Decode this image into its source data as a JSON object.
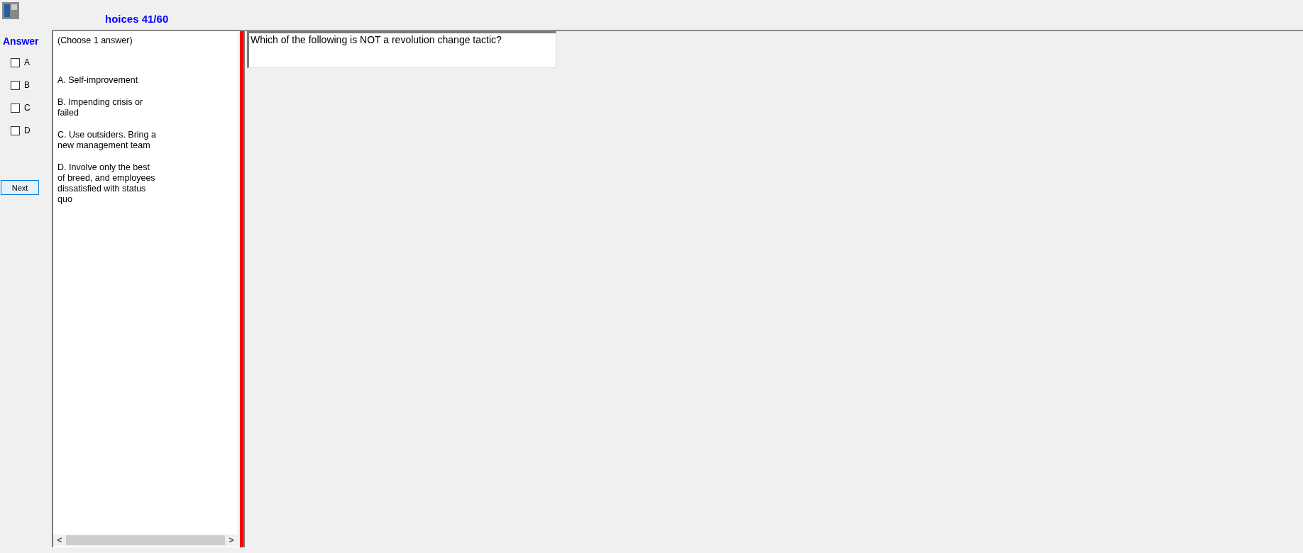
{
  "title": "hoices 41/60",
  "answer_panel": {
    "heading": "Answer",
    "options": [
      {
        "label": "A",
        "checked": false
      },
      {
        "label": "B",
        "checked": false
      },
      {
        "label": "C",
        "checked": false
      },
      {
        "label": "D",
        "checked": false
      }
    ],
    "next_button": "Next"
  },
  "choices_panel": {
    "instruction": "(Choose 1 answer)",
    "choices": [
      "A.  Self-improvement",
      "B.  Impending crisis or failed",
      "C.  Use outsiders. Bring a new management team",
      "D.  Involve only the best of breed, and employees dissatisfied with status quo"
    ],
    "scroll_left": "<",
    "scroll_right": ">"
  },
  "question": "Which of the following is NOT a revolution change tactic?"
}
